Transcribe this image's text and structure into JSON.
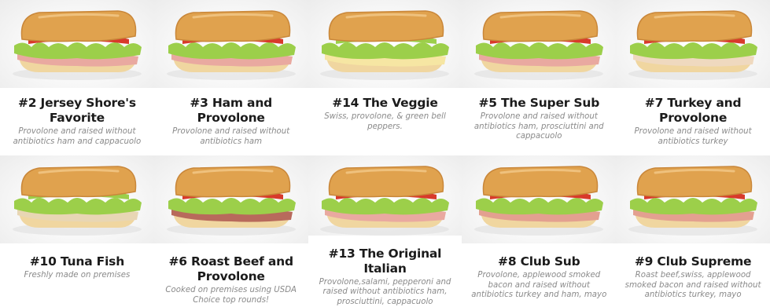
{
  "menu": {
    "items": [
      {
        "name": "#2 Jersey Shore's Favorite",
        "desc": "Provolone and raised without antibiotics ham and cappacuolo"
      },
      {
        "name": "#3 Ham and Provolone",
        "desc": "Provolone and raised without antibiotics ham"
      },
      {
        "name": "#14 The Veggie",
        "desc": "Swiss, provolone, & green bell peppers."
      },
      {
        "name": "#5 The Super Sub",
        "desc": "Provolone and raised without antibiotics ham, prosciuttini and cappacuolo"
      },
      {
        "name": "#7 Turkey and Provolone",
        "desc": "Provolone and raised without antibiotics turkey"
      },
      {
        "name": "#10 Tuna Fish",
        "desc": "Freshly made on premises"
      },
      {
        "name": "#6 Roast Beef and Provolone",
        "desc": "Cooked on premises using USDA Choice top rounds!"
      },
      {
        "name": "#13 The Original Italian",
        "desc": "Provolone,salami, pepperoni and raised without antibiotics ham, prosciuttini, cappacuolo"
      },
      {
        "name": "#8 Club Sub",
        "desc": "Provolone, applewood smoked bacon and raised without antibiotics turkey and ham, mayo"
      },
      {
        "name": "#9 Club Supreme",
        "desc": "Roast beef,swiss, applewood smoked bacon and raised without antibiotics turkey, mayo"
      }
    ]
  },
  "colors": {
    "bread_top": "#e0a24e",
    "bread_crust": "#c9873a",
    "bread_bottom": "#f0d6a0",
    "lettuce": "#9ccf4a",
    "tomato": "#d83a2a",
    "meat": "#e9a9a0",
    "cheese": "#f6e6a3",
    "title": "#1b1b1b",
    "description": "#8a8a8a"
  },
  "fillings": [
    "ham",
    "ham",
    "veggie",
    "ham",
    "turkey",
    "tuna",
    "beef",
    "ham",
    "club",
    "club"
  ]
}
